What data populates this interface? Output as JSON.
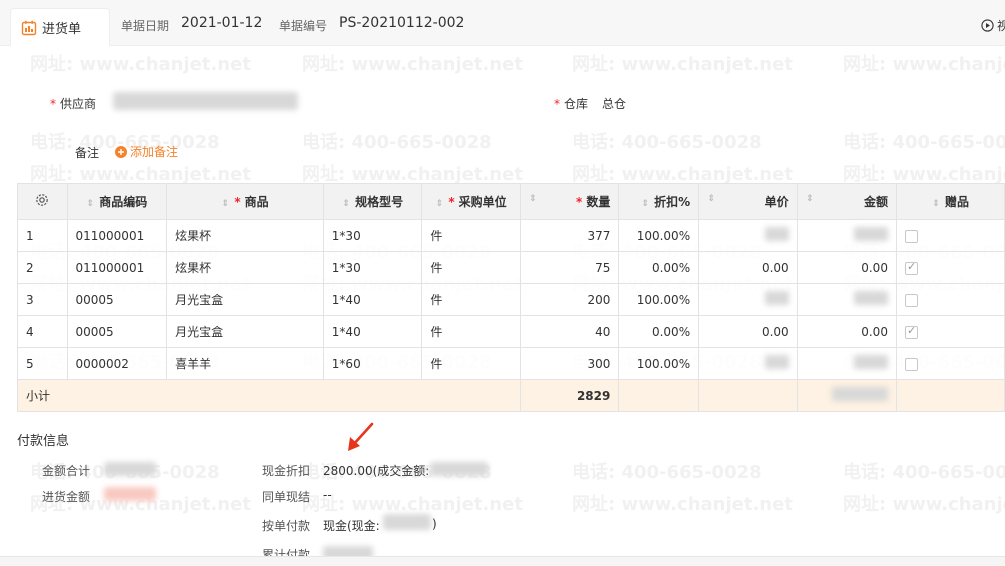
{
  "tab": {
    "label": "进货单",
    "icon": "purchase-doc-icon"
  },
  "header": {
    "date_label": "单据日期",
    "date_value": "2021-01-12",
    "doc_no_label": "单据编号",
    "doc_no_value": "PS-20210112-002",
    "video_label": "视"
  },
  "form": {
    "supplier_label": "供应商",
    "warehouse_label": "仓库",
    "warehouse_value": "总仓",
    "remark_label": "备注",
    "add_remark_label": "添加备注"
  },
  "table": {
    "headers": {
      "code": "商品编码",
      "product": "商品",
      "spec": "规格型号",
      "unit": "采购单位",
      "qty": "数量",
      "discount": "折扣%",
      "price": "单价",
      "amount": "金额",
      "gift": "赠品"
    },
    "rows": [
      {
        "no": "1",
        "code": "011000001",
        "product": "炫果杯",
        "spec": "1*30",
        "unit": "件",
        "qty": "377",
        "discount": "100.00%",
        "price": "",
        "amount": "",
        "gift": false
      },
      {
        "no": "2",
        "code": "011000001",
        "product": "炫果杯",
        "spec": "1*30",
        "unit": "件",
        "qty": "75",
        "discount": "0.00%",
        "price": "0.00",
        "amount": "0.00",
        "gift": true
      },
      {
        "no": "3",
        "code": "00005",
        "product": "月光宝盒",
        "spec": "1*40",
        "unit": "件",
        "qty": "200",
        "discount": "100.00%",
        "price": "",
        "amount": "",
        "gift": false
      },
      {
        "no": "4",
        "code": "00005",
        "product": "月光宝盒",
        "spec": "1*40",
        "unit": "件",
        "qty": "40",
        "discount": "0.00%",
        "price": "0.00",
        "amount": "0.00",
        "gift": true
      },
      {
        "no": "5",
        "code": "0000002",
        "product": "喜羊羊",
        "spec": "1*60",
        "unit": "件",
        "qty": "300",
        "discount": "100.00%",
        "price": "",
        "amount": "",
        "gift": false
      }
    ],
    "subtotal_label": "小计",
    "subtotal_qty": "2829"
  },
  "payment": {
    "title": "付款信息",
    "total_label": "金额合计",
    "purchase_amount_label": "进货金额",
    "cash_discount_label": "现金折扣",
    "cash_discount_value": "2800.00(成交金额:",
    "same_settle_label": "同单现结",
    "same_settle_value": "--",
    "pay_by_order_label": "按单付款",
    "pay_by_order_value": "现金(现金:",
    "pay_by_order_suffix": ")",
    "cumulative_label": "累计付款",
    "cumulative_value": "¥"
  },
  "watermark": {
    "phone": "电话: 400-665-0028",
    "site": "网址: www.chanjet.net"
  },
  "colors": {
    "accent": "#f5822a",
    "required": "#f5222d",
    "subtotal_bg": "#fdf2e3",
    "arrow": "#e8341c"
  }
}
